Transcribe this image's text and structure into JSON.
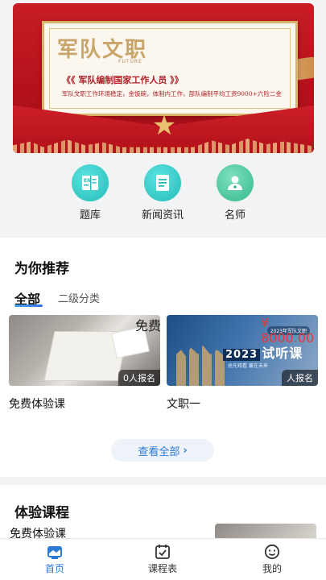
{
  "banner": {
    "title": "军队文职",
    "title_en": "FUTURE",
    "subtitle": "《《 军队编制国家工作人员 》》",
    "description": "军队文职工作环境稳定，金饭碗，体制内工作，部队编制平均工资9000+六险二金"
  },
  "quick_links": [
    {
      "label": "题库",
      "icon": "book-icon"
    },
    {
      "label": "新闻资讯",
      "icon": "news-icon"
    },
    {
      "label": "名师",
      "icon": "teacher-icon"
    }
  ],
  "recommend": {
    "title": "为你推荐",
    "tabs": [
      "全部",
      "二级分类"
    ],
    "active_tab": "全部",
    "courses": [
      {
        "name": "免费体验课",
        "enrolled": "0人报名",
        "price": "免费",
        "price_color": "#222222",
        "thumb": "books-desk"
      },
      {
        "name": "文职一",
        "enrolled": "人报名",
        "price": "¥ 8000.00",
        "price_color": "#e4393c",
        "thumb": "trial-class",
        "thumb_text": {
          "tag": "2023年军队文职",
          "year": "2023",
          "headline": "试听课",
          "small": "抢先观看 赢在未来"
        }
      }
    ],
    "view_all": "查看全部"
  },
  "trial": {
    "title": "体验课程",
    "first_course": "免费体验课"
  },
  "tabbar": [
    {
      "label": "首页",
      "icon": "home-icon",
      "active": true
    },
    {
      "label": "课程表",
      "icon": "calendar-icon",
      "active": false
    },
    {
      "label": "我的",
      "icon": "profile-icon",
      "active": false
    }
  ],
  "colors": {
    "accent": "#2b7ad6",
    "price_red": "#e4393c",
    "icon_teal": "#23bdb9",
    "icon_green": "#33b98d",
    "banner_red": "#c81d25"
  }
}
